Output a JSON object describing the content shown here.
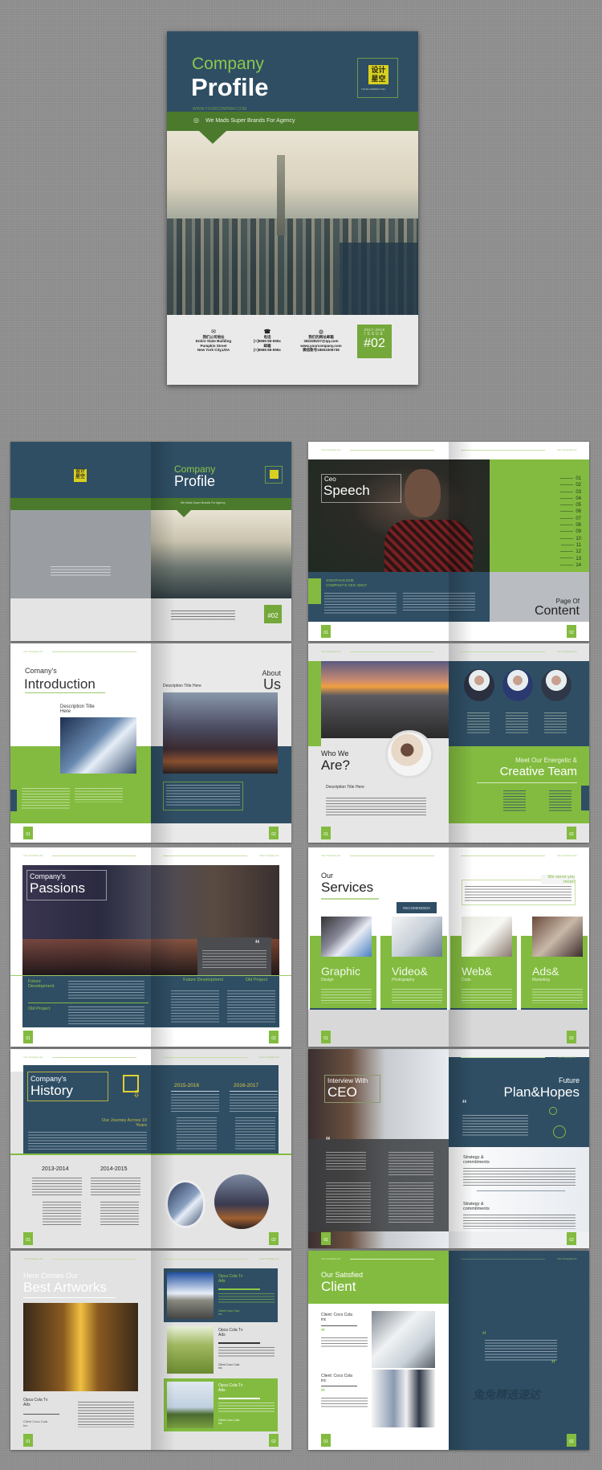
{
  "colors": {
    "navy": "#2f4e64",
    "green": "#82bb3f",
    "dark_green": "#4b7a2c",
    "background": "#8c8c8c"
  },
  "header_label": "Your Company Inc",
  "page_numbers": [
    "01",
    "02"
  ],
  "cover": {
    "title_line1": "Company",
    "title_line2": "Profile",
    "website": "WWW.YOURCOMPANY.COM",
    "logo_text": "设计星空",
    "logo_caption": "YOUR COMPANY INC",
    "tagline": "We Mads Super Brands For Agency",
    "tagline_icon": "globe-search-icon",
    "contacts": [
      {
        "icon": "mail-icon",
        "lines": [
          "我们公司地址",
          "Entire State Building",
          "Pumpkin Street",
          "New York City,USA"
        ]
      },
      {
        "icon": "phone-icon",
        "lines": [
          "电话",
          "[+]5555-55-555x",
          "邮箱",
          "[+]5555-55-555x"
        ]
      },
      {
        "icon": "globe-icon",
        "lines": [
          "我们的网址邮箱",
          "282328227@qq.com",
          "www.yourcompany.com",
          "微信账号18603306738"
        ]
      }
    ],
    "issue": {
      "years": "2017-2018",
      "label": "ISSUE",
      "number": "#02"
    }
  },
  "ceo_speech": {
    "title_small": "Ceo",
    "title_big": "Speech",
    "name": "JONATHAN DOE",
    "role": "COMPANY'S CEO 42017",
    "toc_numbers": [
      "01",
      "02",
      "03",
      "04",
      "05",
      "06",
      "07",
      "08",
      "09",
      "10",
      "11",
      "12",
      "13",
      "14"
    ],
    "toc_title_small": "Page Of",
    "toc_title_big": "Content"
  },
  "introduction": {
    "title_small": "Comany's",
    "title_big": "Introduction",
    "desc_title": "Description Title Here",
    "about_small": "About",
    "about_big": "Us",
    "about_desc": "Description Title Here"
  },
  "team": {
    "who_small": "Who We",
    "who_big": "Are?",
    "desc_title": "Description Title Here",
    "meet": "Meet Our Energetic &",
    "creative": "Creative Team"
  },
  "passions": {
    "title_small": "Company's",
    "title_big": "Passions",
    "labels": [
      "Future Development",
      "Old Project",
      "Future Development",
      "Old Project"
    ],
    "quote_icon": "quote-icon"
  },
  "services": {
    "title_small": "Our",
    "title_big": "Services",
    "badge": "RECOMENDED!",
    "serve": "We serve you more!",
    "items": [
      {
        "title": "Graphic",
        "sub": "Design"
      },
      {
        "title": "Video&",
        "sub": "Photography"
      },
      {
        "title": "Web&",
        "sub": "Cods"
      },
      {
        "title": "Ads&",
        "sub": "Marketing"
      }
    ]
  },
  "history": {
    "title_small": "Company's",
    "title_big": "History",
    "journey": "Our Journey Across 10 Years",
    "icon": "floppy-download-icon",
    "years_top": [
      "2015-2016",
      "2016-2017"
    ],
    "years_bottom": [
      "2013-2014",
      "2014-2015"
    ]
  },
  "interview": {
    "title_small": "Interview With",
    "title_big": "CEO",
    "future_small": "Future",
    "future_big": "Plan&Hopes",
    "strategy": [
      "Strategy & commitments",
      "Strategy & commitments"
    ]
  },
  "artworks": {
    "title_small": "Here Comes Our",
    "title_big": "Best Artworks",
    "caption": "Opca Cola Tv Ads",
    "client": "Client Coco Cola Inc",
    "cards": [
      {
        "title": "Opca Cola Tv Ads",
        "client": "Client Coco Cola Inc"
      },
      {
        "title": "Opca Cola Tv Ads",
        "client": "Client Coco Cola Inc"
      },
      {
        "title": "Opca Cola Tv Ads",
        "client": "Client Coco Cola Inc"
      }
    ]
  },
  "clients": {
    "title_small": "Our Satisfied",
    "title_big": "Client",
    "items": [
      {
        "label": "Client: Coco Cola inc"
      },
      {
        "label": "Client: Coco Cola inc"
      }
    ],
    "watermark": "兔兔精选速达"
  }
}
